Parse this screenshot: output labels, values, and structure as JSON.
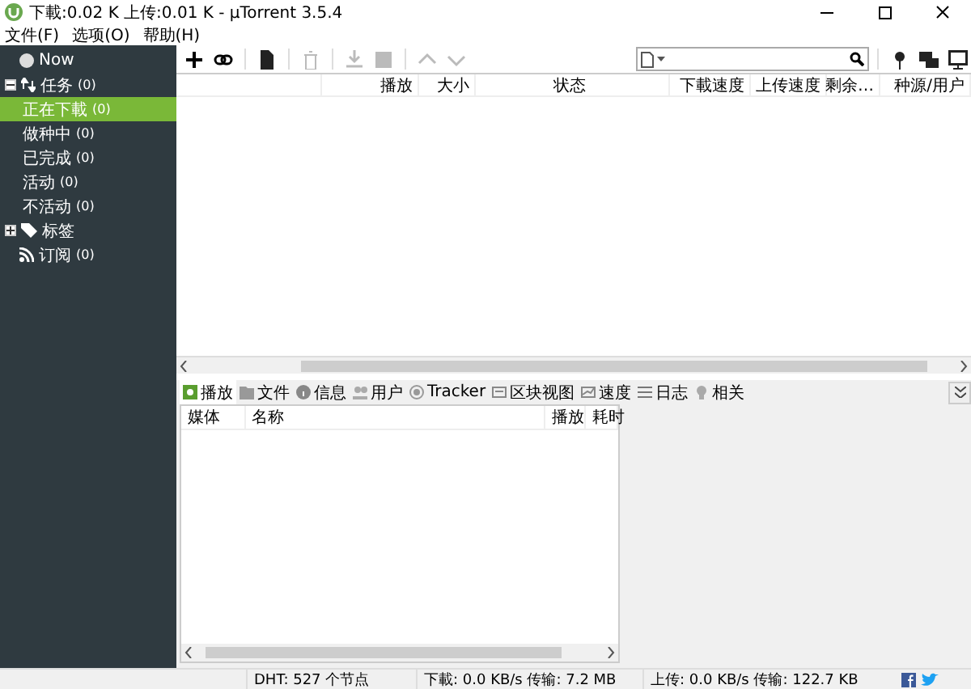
{
  "window": {
    "title": "下載:0.02 K 上传:0.01 K - µTorrent 3.5.4"
  },
  "menu": [
    "文件(F)",
    "选项(O)",
    "帮助(H)"
  ],
  "sidebar": {
    "items": [
      {
        "kind": "now",
        "label": "Now"
      },
      {
        "kind": "group",
        "label": "任务",
        "count": "(0)",
        "expanded": true,
        "children": [
          {
            "label": "正在下載",
            "count": "(0)",
            "selected": true
          },
          {
            "label": "做种中",
            "count": "(0)",
            "selected": false
          },
          {
            "label": "已完成",
            "count": "(0)",
            "selected": false
          },
          {
            "label": "活动",
            "count": "(0)",
            "selected": false
          },
          {
            "label": "不活动",
            "count": "(0)",
            "selected": false
          }
        ]
      },
      {
        "kind": "labels",
        "label": "标签",
        "expanded": false
      },
      {
        "kind": "feeds",
        "label": "订阅",
        "count": "(0)"
      }
    ]
  },
  "table": {
    "columns": [
      "",
      "播放",
      "大小",
      "状态",
      "下載速度",
      "上传速度",
      "剩余…",
      "种源/用户"
    ]
  },
  "detail_tabs": [
    {
      "label": "播放",
      "selected": true
    },
    {
      "label": "文件",
      "selected": false
    },
    {
      "label": "信息",
      "selected": false
    },
    {
      "label": "用户",
      "selected": false
    },
    {
      "label": "Tracker",
      "selected": false
    },
    {
      "label": "区块视图",
      "selected": false
    },
    {
      "label": "速度",
      "selected": false
    },
    {
      "label": "日志",
      "selected": false
    },
    {
      "label": "相关",
      "selected": false
    }
  ],
  "media_table": {
    "columns": [
      "媒体",
      "名称",
      "播放",
      "耗时"
    ]
  },
  "status_bar": [
    "DHT: 527 个节点",
    "下載: 0.0 KB/s 传输: 7.2 MB",
    "上传: 0.0 KB/s 传输: 122.7 KB"
  ]
}
